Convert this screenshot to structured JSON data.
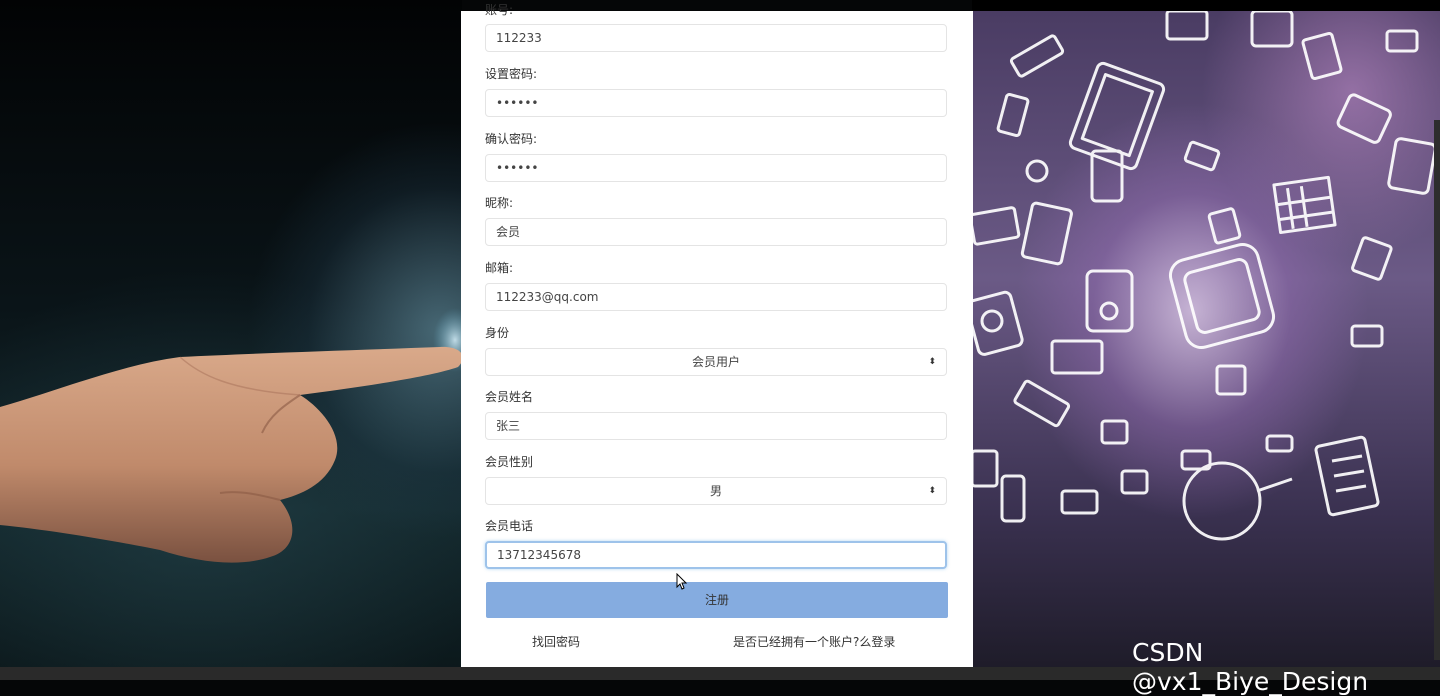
{
  "form": {
    "username_label": "账号:",
    "username_value": "112233",
    "password_label": "设置密码:",
    "password_value": "••••••",
    "confirm_label": "确认密码:",
    "confirm_value": "••••••",
    "nickname_label": "昵称:",
    "nickname_value": "会员",
    "email_label": "邮箱:",
    "email_value": "112233@qq.com",
    "role_label": "身份",
    "role_value": "会员用户",
    "name_label": "会员姓名",
    "name_value": "张三",
    "gender_label": "会员性别",
    "gender_value": "男",
    "phone_label": "会员电话",
    "phone_value": "13712345678",
    "submit_label": "注册",
    "forgot_link": "找回密码",
    "login_link": "是否已经拥有一个账户?么登录"
  },
  "select_arrow": "⬍",
  "watermark": "CSDN @vx1_Biye_Design",
  "colors": {
    "submit_bg": "#85ace0",
    "focus_border": "#9ec3ea"
  }
}
